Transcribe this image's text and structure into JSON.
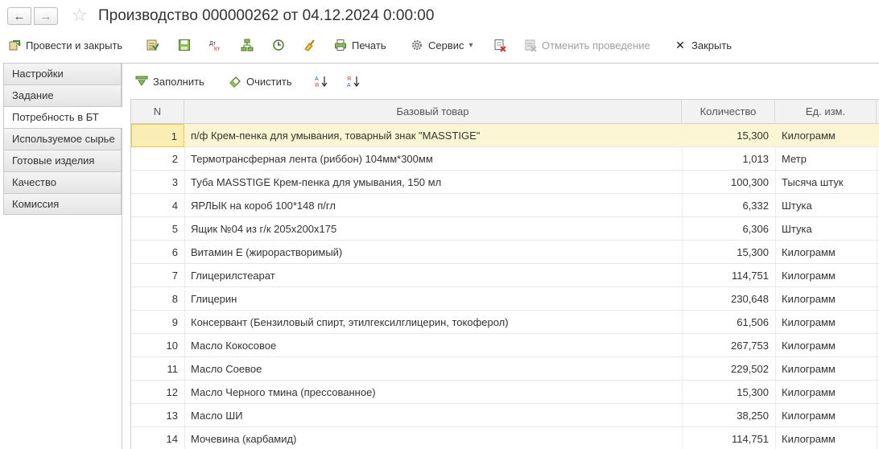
{
  "title": "Производство 000000262 от 04.12.2024 0:00:00",
  "nav": {
    "back": "←",
    "forward": "→",
    "star": "☆"
  },
  "toolbar": {
    "post_and_close": "Провести и закрыть",
    "print": "Печать",
    "service": "Сервис",
    "service_arrow": "▾",
    "cancel_posting": "Отменить проведение",
    "close": "Закрыть",
    "close_glyph": "✕"
  },
  "tabs": [
    {
      "label": "Настройки"
    },
    {
      "label": "Задание"
    },
    {
      "label": "Потребность в БТ"
    },
    {
      "label": "Используемое сырье"
    },
    {
      "label": "Готовые изделия"
    },
    {
      "label": "Качество"
    },
    {
      "label": "Комиссия"
    }
  ],
  "subtoolbar": {
    "fill": "Заполнить",
    "clear": "Очистить"
  },
  "table": {
    "columns": {
      "n": "N",
      "name": "Базовый товар",
      "qty": "Количество",
      "unit": "Ед. изм."
    },
    "rows": [
      {
        "n": "1",
        "name": "п/ф Крем-пенка для умывания, товарный знак \"MASSTIGE\"",
        "qty": "15,300",
        "unit": "Килограмм"
      },
      {
        "n": "2",
        "name": "Термотрансферная лента  (риббон) 104мм*300мм",
        "qty": "1,013",
        "unit": "Метр"
      },
      {
        "n": "3",
        "name": "Туба MASSTIGE  Крем-пенка для умывания, 150 мл",
        "qty": "100,300",
        "unit": "Тысяча штук"
      },
      {
        "n": "4",
        "name": "ЯРЛЫК на короб  100*148 п/гл",
        "qty": "6,332",
        "unit": "Штука"
      },
      {
        "n": "5",
        "name": "Ящик №04 из г/к 205х200х175",
        "qty": "6,306",
        "unit": "Штука"
      },
      {
        "n": "6",
        "name": "Витамин Е (жирорастворимый)",
        "qty": "15,300",
        "unit": "Килограмм"
      },
      {
        "n": "7",
        "name": "Глицерилстеарат",
        "qty": "114,751",
        "unit": "Килограмм"
      },
      {
        "n": "8",
        "name": "Глицерин",
        "qty": "230,648",
        "unit": "Килограмм"
      },
      {
        "n": "9",
        "name": "Консервант (Бензиловый спирт, этилгексилглицерин, токоферол)",
        "qty": "61,506",
        "unit": "Килограмм"
      },
      {
        "n": "10",
        "name": "Масло Кокосовое",
        "qty": "267,753",
        "unit": "Килограмм"
      },
      {
        "n": "11",
        "name": "Масло Соевое",
        "qty": "229,502",
        "unit": "Килограмм"
      },
      {
        "n": "12",
        "name": "Масло Черного тмина (прессованное)",
        "qty": "15,300",
        "unit": "Килограмм"
      },
      {
        "n": "13",
        "name": "Масло ШИ",
        "qty": "38,250",
        "unit": "Килограмм"
      },
      {
        "n": "14",
        "name": "Мочевина (карбамид)",
        "qty": "114,751",
        "unit": "Килограмм"
      }
    ]
  }
}
